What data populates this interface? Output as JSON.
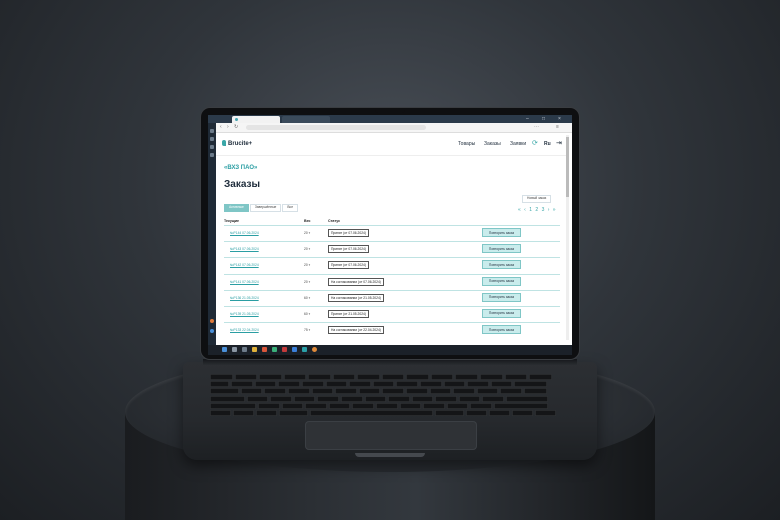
{
  "scene": "laptop-on-pedestal",
  "site": {
    "logo": "Brucite+",
    "nav": [
      "Товары",
      "Заказы",
      "Заявки"
    ],
    "user_short": "Ru",
    "company": "«ВХЗ ПАО»",
    "title": "Заказы",
    "filters": [
      "Активные",
      "Завершённые",
      "Все"
    ],
    "new_order_label": "Новый заказ",
    "pager": "« ‹ 1 2 3 › »",
    "columns": [
      "Текущие",
      "Вес",
      "Статус"
    ]
  },
  "orders": [
    {
      "id": "№Р144 07.06.2024",
      "weight": "20 т",
      "status": "Принят (от 07.06.2024)",
      "action": "Повторить заказ"
    },
    {
      "id": "№Р143 07.06.2024",
      "weight": "20 т",
      "status": "Принят (от 07.06.2024)",
      "action": "Повторить заказ"
    },
    {
      "id": "№Р142 07.06.2024",
      "weight": "20 т",
      "status": "Принят (от 07.06.2024)",
      "action": "Повторить заказ"
    },
    {
      "id": "№Р141 07.06.2024",
      "weight": "20 т",
      "status": "На согласовании (от 07.06.2024)",
      "action": "Повторить заказ"
    },
    {
      "id": "№Р136 21.05.2024",
      "weight": "60 т",
      "status": "На согласовании (от 21.05.2024)",
      "action": "Повторить заказ"
    },
    {
      "id": "№Р139 21.05.2024",
      "weight": "60 т",
      "status": "Принят (от 21.05.2024)",
      "action": "Повторить заказ"
    },
    {
      "id": "№Р133 22.04.2024",
      "weight": "75 т",
      "status": "На согласовании (от 22.04.2024)",
      "action": "Повторить заказ"
    }
  ],
  "colors": {
    "accent": "#3aa7a8",
    "button_bg": "#c9ecec",
    "taskbar": "#1b2129"
  }
}
